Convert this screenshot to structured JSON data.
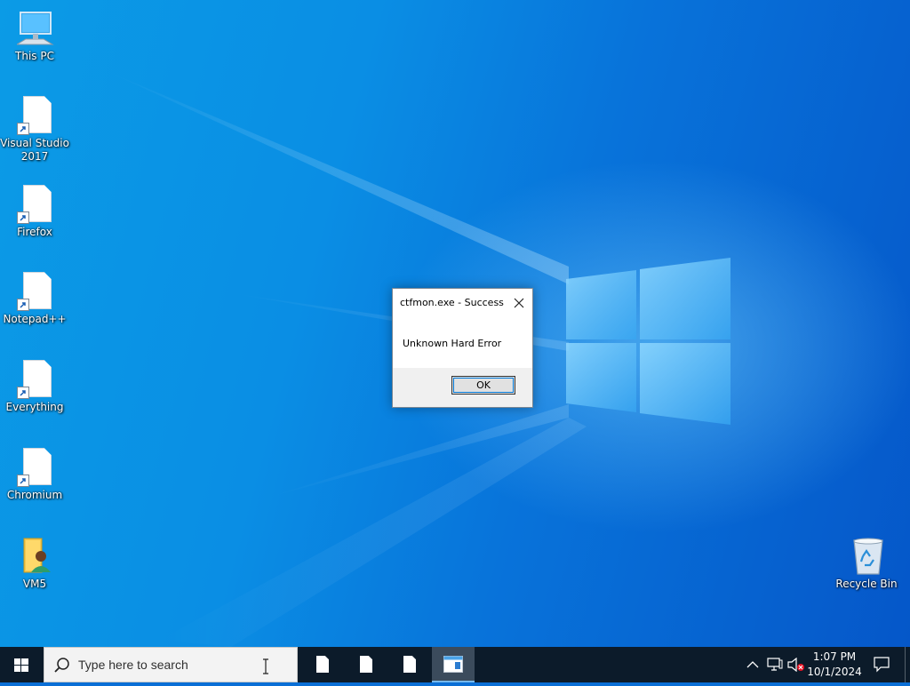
{
  "desktop": {
    "icons": [
      {
        "label": "This PC"
      },
      {
        "label": "Visual Studio 2017"
      },
      {
        "label": "Firefox"
      },
      {
        "label": "Notepad++"
      },
      {
        "label": "Everything"
      },
      {
        "label": "Chromium"
      },
      {
        "label": "VM5"
      },
      {
        "label": "Recycle Bin"
      }
    ]
  },
  "dialog": {
    "title": "ctfmon.exe - Success",
    "message": "Unknown Hard Error",
    "ok_label": "OK"
  },
  "taskbar": {
    "search_placeholder": "Type here to search",
    "clock": {
      "time": "1:07 PM",
      "date": "10/1/2024"
    }
  },
  "colors": {
    "accent": "#0078d7",
    "taskbar": "#0c1b2a",
    "desktop": "#0a8ee4"
  },
  "icons": {
    "start": "windows-logo-icon",
    "search": "search-icon",
    "tray": [
      "chevron-up-icon",
      "network-icon",
      "volume-muted-icon",
      "notification-icon"
    ]
  }
}
